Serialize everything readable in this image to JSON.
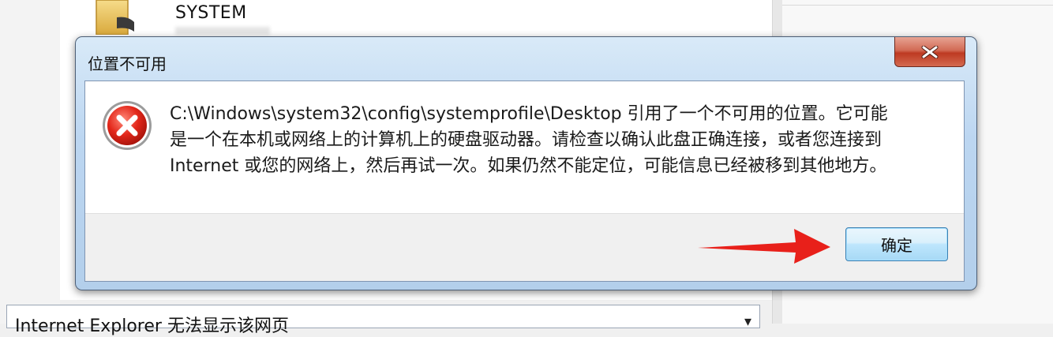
{
  "background": {
    "folder_name": "SYSTEM",
    "address_bar_text": "Internet Explorer 无法显示该网页"
  },
  "dialog": {
    "title": "位置不可用",
    "message": "C:\\Windows\\system32\\config\\systemprofile\\Desktop 引用了一个不可用的位置。它可能\n是一个在本机或网络上的计算机上的硬盘驱动器。请检查以确认此盘正确连接，或者您连接到\nInternet 或您的网络上，然后再试一次。如果仍然不能定位，可能信息已经被移到其他地方。",
    "ok_label": "确定",
    "icons": {
      "error": "error-icon",
      "close": "close-icon"
    }
  },
  "annotation": {
    "arrow_color": "#e8201a"
  }
}
